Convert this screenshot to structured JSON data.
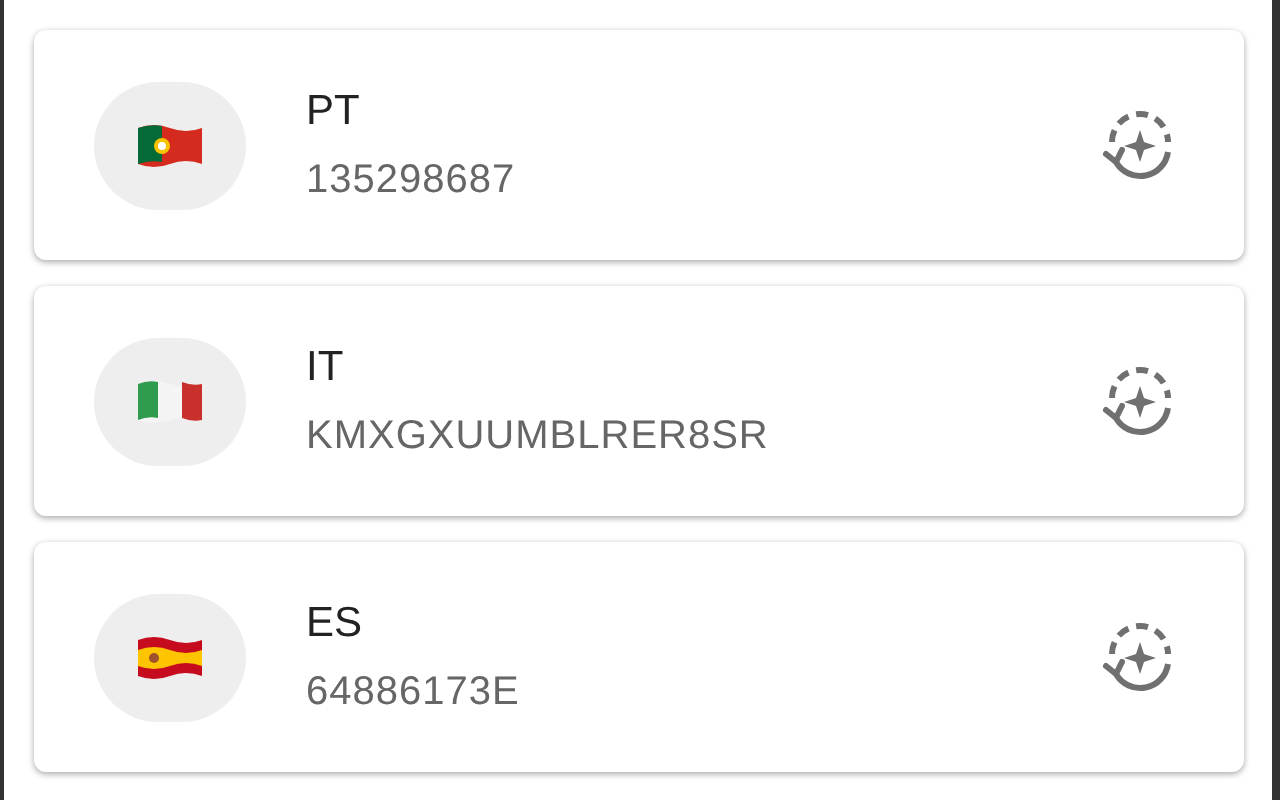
{
  "entries": [
    {
      "kind": "portugal",
      "code": "PT",
      "number": "135298687"
    },
    {
      "kind": "italy",
      "code": "IT",
      "number": "KMXGXUUMBLRER8SR"
    },
    {
      "kind": "spain",
      "code": "ES",
      "number": "64886173E"
    }
  ]
}
